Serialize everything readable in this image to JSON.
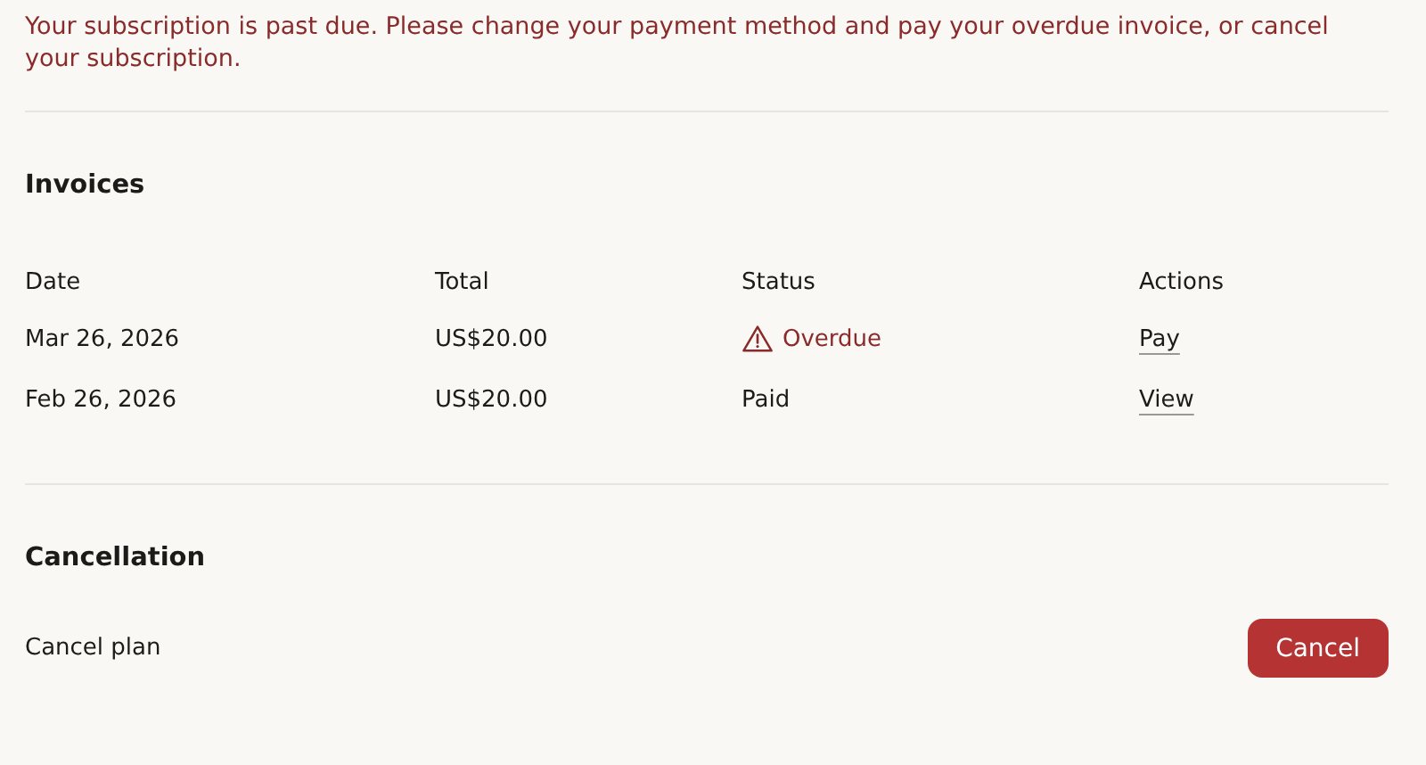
{
  "alert": {
    "message": "Your subscription is past due. Please change your payment method and pay your overdue invoice, or cancel your subscription."
  },
  "invoices": {
    "title": "Invoices",
    "columns": [
      "Date",
      "Total",
      "Status",
      "Actions"
    ],
    "rows": [
      {
        "date": "Mar 26, 2026",
        "total": "US$20.00",
        "status": {
          "kind": "overdue",
          "label": "Overdue"
        },
        "action": "Pay"
      },
      {
        "date": "Feb 26, 2026",
        "total": "US$20.00",
        "status": {
          "kind": "paid",
          "label": "Paid"
        },
        "action": "View"
      }
    ]
  },
  "cancellation": {
    "title": "Cancellation",
    "label": "Cancel plan",
    "button": "Cancel"
  }
}
